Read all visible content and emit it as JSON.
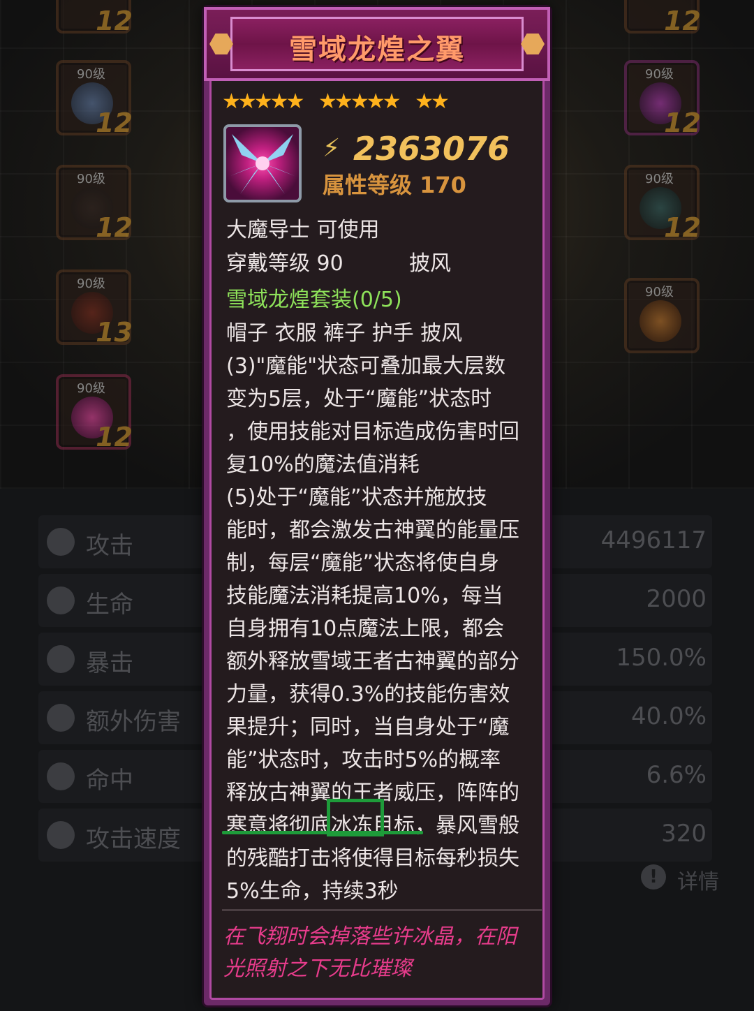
{
  "tooltip": {
    "title": "雪域龙煌之翼",
    "stars": [
      "★★★★★",
      "★★★★★",
      "★★"
    ],
    "score": "2363076",
    "attr_level": "属性等级 170",
    "usable_by": "大魔导士 可使用",
    "wear_level": "穿戴等级 90",
    "slot_type": "披风",
    "set_name": "雪域龙煌套装(0/5)",
    "set_pieces": "帽子 衣服 裤子 护手 披风",
    "effect_lines": [
      "(3)\"魔能\"状态可叠加最大层数",
      "变为5层，处于“魔能”状态时",
      "，使用技能对目标造成伤害时回",
      "复10%的魔法值消耗",
      "(5)处于“魔能”状态并施放技",
      "能时，都会激发古神翼的能量压",
      "制，每层“魔能”状态将使自身",
      "技能魔法消耗提高10%，每当",
      "自身拥有10点魔法上限，都会",
      "额外释放雪域王者古神翼的部分",
      "力量，获得0.3%的技能伤害效",
      "果提升；同时，当自身处于“魔",
      "能”状态时，攻击时5%的概率",
      "释放古神翼的王者威压，阵阵的",
      "寒意将彻底冰冻目标，暴风雪般",
      "的残酷打击将使得目标每秒损失",
      "5%生命，持续3秒"
    ],
    "flavor_lines": [
      "在飞翔时会掉落些许冰晶，在阳",
      "光照射之下无比璀璨"
    ]
  },
  "equipment_slots": {
    "left": [
      {
        "level": "",
        "count": "12"
      },
      {
        "level": "90级",
        "count": "12"
      },
      {
        "level": "90级",
        "count": "12"
      },
      {
        "level": "90级",
        "count": "13"
      },
      {
        "level": "90级",
        "count": "12"
      }
    ],
    "right": [
      {
        "level": "",
        "count": "12"
      },
      {
        "level": "90级",
        "count": "12"
      },
      {
        "level": "90级",
        "count": "12"
      },
      {
        "level": "90级",
        "count": ""
      }
    ]
  },
  "stats": [
    {
      "icon": "sword-icon",
      "label": "攻击",
      "value": "4496117"
    },
    {
      "icon": "heart-icon",
      "label": "生命",
      "value": "2000"
    },
    {
      "icon": "crit-icon",
      "label": "暴击",
      "value": "150.0%"
    },
    {
      "icon": "extra-damage-icon",
      "label": "额外伤害",
      "value": "40.0%"
    },
    {
      "icon": "target-icon",
      "label": "命中",
      "value": "6.6%"
    },
    {
      "icon": "speed-icon",
      "label": "攻击速度",
      "value": "320"
    }
  ],
  "detail_button": {
    "label": "详情"
  },
  "colors": {
    "title": "#ff9a6a",
    "set_name": "#8ee25a",
    "flavor": "#e83c8c",
    "score": "#f2c15c",
    "annotation": "#1e9b3a"
  }
}
